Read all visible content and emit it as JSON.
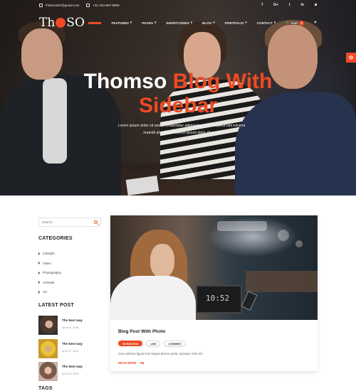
{
  "topbar": {
    "email": "frlofenus67@gmail.com",
    "phone": "+01-234-567-8900",
    "socials": [
      "f",
      "G+",
      "t",
      "in",
      "◙"
    ]
  },
  "nav": {
    "logo": {
      "before": "Th",
      "after": "SO"
    },
    "items": [
      {
        "label": "FEATURES",
        "caret": "▾"
      },
      {
        "label": "PAGES",
        "caret": "▾"
      },
      {
        "label": "SHORTCODES",
        "caret": "▾"
      },
      {
        "label": "BLOG",
        "caret": "▾"
      },
      {
        "label": "PORTFOLIO",
        "caret": "▾"
      },
      {
        "label": "CONTACT",
        "caret": "▾"
      }
    ],
    "cart_label": "Cart",
    "cart_count": "0"
  },
  "hero": {
    "title_plain": "Thomso ",
    "title_accent": "Blog With",
    "title_line2": "Sidebar",
    "subtitle": "Lorem ipsum dolor sit amet, consectetur adipisicing elit Excepteur sint minima impedit aliquam id. Lorem ipsum dolor sit amet"
  },
  "sidebar": {
    "search_placeholder": "Search...",
    "categories_heading": "CATEGORIES",
    "categories": [
      "Lifestyle",
      "Video",
      "Photography",
      "Animals",
      "Art"
    ],
    "latest_heading": "LATEST POST",
    "latest_posts": [
      {
        "title": "The best way",
        "date": "April 02, 2018"
      },
      {
        "title": "The best way",
        "date": "April 02, 2018"
      },
      {
        "title": "The best way",
        "date": "April 02, 2018"
      }
    ],
    "tags_heading": "TAGS"
  },
  "post": {
    "title": "Blog Post With Photo",
    "date": "08 MAR 2018",
    "likes": "LIKE",
    "comments": "COMMENT",
    "excerpt": "Cras ultricies ligula sed magna dictum porta. Quisque velit nisi.",
    "read_more": "READ MORE",
    "image_clock": "10:52"
  },
  "colors": {
    "accent": "#ef4a24",
    "text_dark": "#222222"
  }
}
